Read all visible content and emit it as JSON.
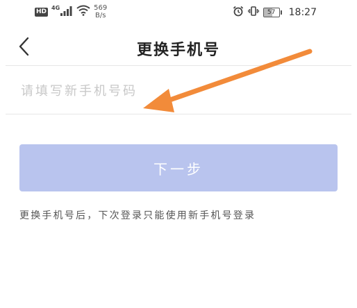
{
  "status_bar": {
    "hd_badge": "HD",
    "network_type": "4G",
    "speed_value": "569",
    "speed_unit": "B/s",
    "battery_level": "57",
    "time": "18:27",
    "icons": [
      "signal-icon",
      "wifi-icon",
      "alarm-icon",
      "vibrate-icon",
      "battery-icon"
    ]
  },
  "header": {
    "title": "更换手机号",
    "back_icon": "chevron-left-icon"
  },
  "form": {
    "phone_value": "",
    "phone_placeholder": "请填写新手机号码",
    "next_label": "下一步"
  },
  "hint_text": "更换手机号后，下次登录只能使用新手机号登录",
  "annotation": {
    "arrow_icon": "arrow-annotation",
    "arrow_color": "#f28b3a"
  },
  "colors": {
    "button_bg": "#b9c4ee",
    "placeholder": "#c8c8c8",
    "title": "#222222"
  }
}
